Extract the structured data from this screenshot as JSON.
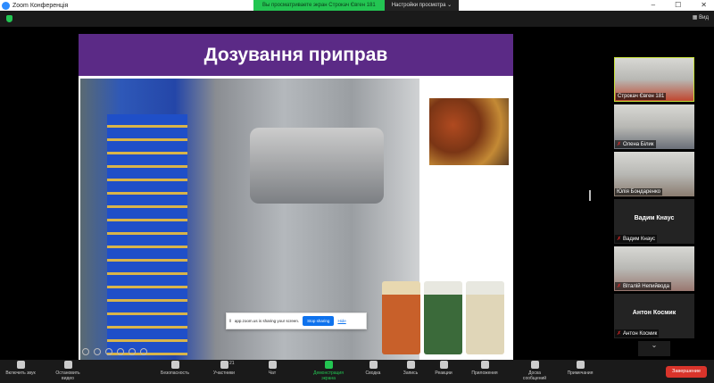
{
  "window": {
    "title": "Zoom Конференція",
    "minimize": "–",
    "maximize": "☐",
    "close": "✕"
  },
  "banner": {
    "viewing": "Вы просматриваете экран Строкач Євген 181",
    "options": "Настройки просмотра",
    "chevron": "⌄"
  },
  "topbar": {
    "view_label": "Вид"
  },
  "slide": {
    "title": "Дозування приправ"
  },
  "share_bar": {
    "message": "app.zoom.us is sharing your screen.",
    "stop": "Stop sharing",
    "hide": "Hide"
  },
  "participants": [
    {
      "name": "Строкач Євген 181",
      "video": true,
      "muted": false,
      "active": true,
      "color": "#c0472f"
    },
    {
      "name": "Олена Білик",
      "video": true,
      "muted": true,
      "color": "#6a6f78"
    },
    {
      "name": "Юлія Бондаренко",
      "video": true,
      "muted": false,
      "color": "#8a7c70"
    },
    {
      "name": "Вадим Кнаус",
      "video": false,
      "muted": true,
      "display": "Вадим Кнаус"
    },
    {
      "name": "Віталій Непийвода",
      "video": true,
      "muted": true,
      "color": "#9a7870"
    },
    {
      "name": "Антон Космик",
      "video": false,
      "muted": true,
      "display": "Антон Космик"
    }
  ],
  "toolbar": {
    "items": [
      {
        "label": "Включить звук",
        "icon": "mic-muted-icon"
      },
      {
        "label": "Остановить видео",
        "icon": "video-icon"
      },
      {
        "label": "Безопасность",
        "icon": "shield-icon"
      },
      {
        "label": "Участники",
        "icon": "participants-icon",
        "count": "21"
      },
      {
        "label": "Чат",
        "icon": "chat-icon"
      },
      {
        "label": "Демонстрация экрана",
        "icon": "share-screen-icon"
      },
      {
        "label": "Сводка",
        "icon": "summary-icon"
      },
      {
        "label": "Запись",
        "icon": "record-icon"
      },
      {
        "label": "Реакции",
        "icon": "reactions-icon"
      },
      {
        "label": "Приложения",
        "icon": "apps-icon"
      },
      {
        "label": "Доска сообщений",
        "icon": "whiteboard-icon"
      },
      {
        "label": "Примечания",
        "icon": "notes-icon"
      }
    ],
    "end": "Завершение"
  },
  "colors": {
    "accent": "#23c552",
    "slide_header": "#5b2a86",
    "end": "#d9342b"
  }
}
